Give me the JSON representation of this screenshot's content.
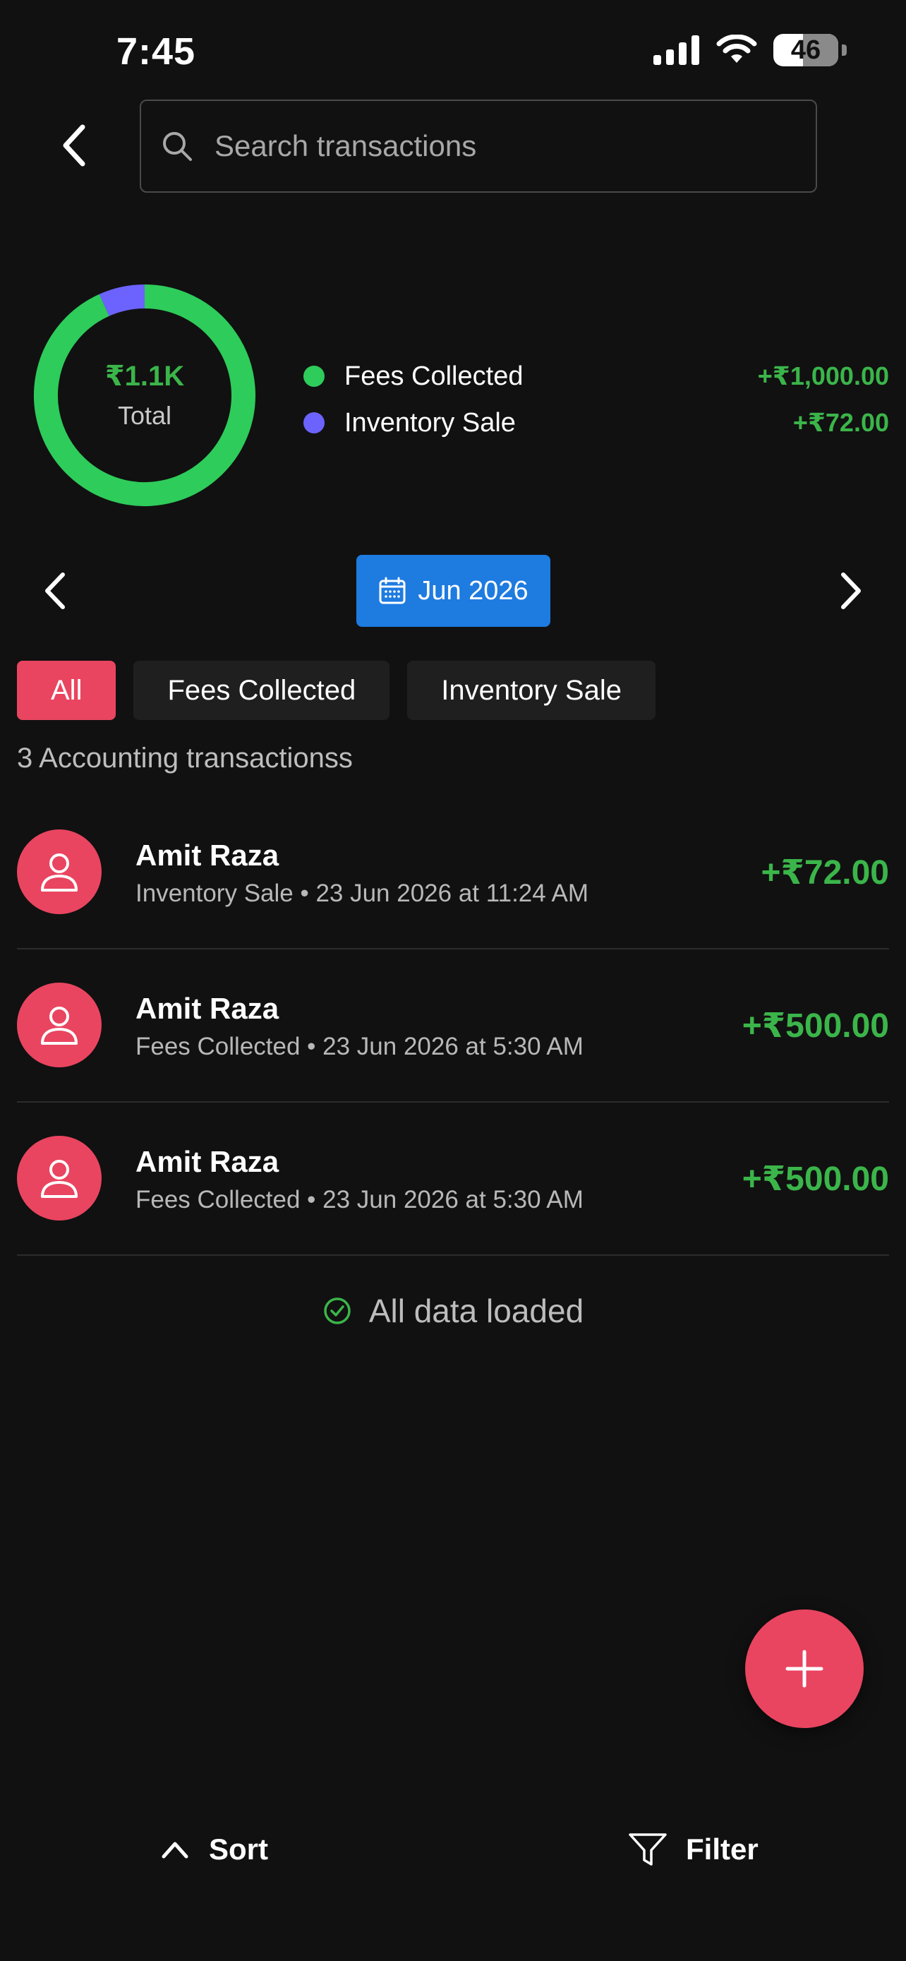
{
  "status_bar": {
    "time": "7:45",
    "battery": "46",
    "battery_level": 0.46,
    "icons": [
      "signal-icon",
      "wifi-icon",
      "battery-icon"
    ]
  },
  "header": {
    "back_icon": "chevron-left-icon",
    "search_icon": "search-icon",
    "search_placeholder": "Search transactions",
    "search_value": ""
  },
  "summary": {
    "total_value": "₹1.1K",
    "total_label": "Total",
    "donut_colors": [
      "#2ecc5a",
      "#6c63ff"
    ],
    "legend": [
      {
        "name": "Fees Collected",
        "amount": "+₹1,000.00",
        "color": "#2ecc5a",
        "value": 1000
      },
      {
        "name": "Inventory Sale",
        "amount": "+₹72.00",
        "color": "#6c63ff",
        "value": 72
      }
    ]
  },
  "month_nav": {
    "prev_icon": "chevron-left-icon",
    "next_icon": "chevron-right-icon",
    "calendar_icon": "calendar-icon",
    "label": "Jun 2026",
    "color": "#1e7be0"
  },
  "filters": {
    "chips": [
      {
        "label": "All",
        "active": true
      },
      {
        "label": "Fees Collected",
        "active": false
      },
      {
        "label": "Inventory Sale",
        "active": false
      }
    ],
    "active_color": "#e94560"
  },
  "count_text": "3 Accounting transactionss",
  "transactions": [
    {
      "name": "Amit Raza",
      "meta": "Inventory Sale • 23 Jun 2026 at 11:24 AM",
      "amount": "+₹72.00"
    },
    {
      "name": "Amit Raza",
      "meta": "Fees Collected • 23 Jun 2026 at 5:30 AM",
      "amount": "+₹500.00"
    },
    {
      "name": "Amit Raza",
      "meta": "Fees Collected • 23 Jun 2026 at 5:30 AM",
      "amount": "+₹500.00"
    }
  ],
  "loaded_text": "All data loaded",
  "fab_icon": "plus-icon",
  "bottom_bar": {
    "sort_label": "Sort",
    "sort_icon": "chevron-up-icon",
    "filter_label": "Filter",
    "filter_icon": "filter-icon"
  },
  "colors": {
    "background": "#111111",
    "positive": "#3bb54a",
    "accent": "#e94560",
    "primary": "#1e7be0"
  }
}
